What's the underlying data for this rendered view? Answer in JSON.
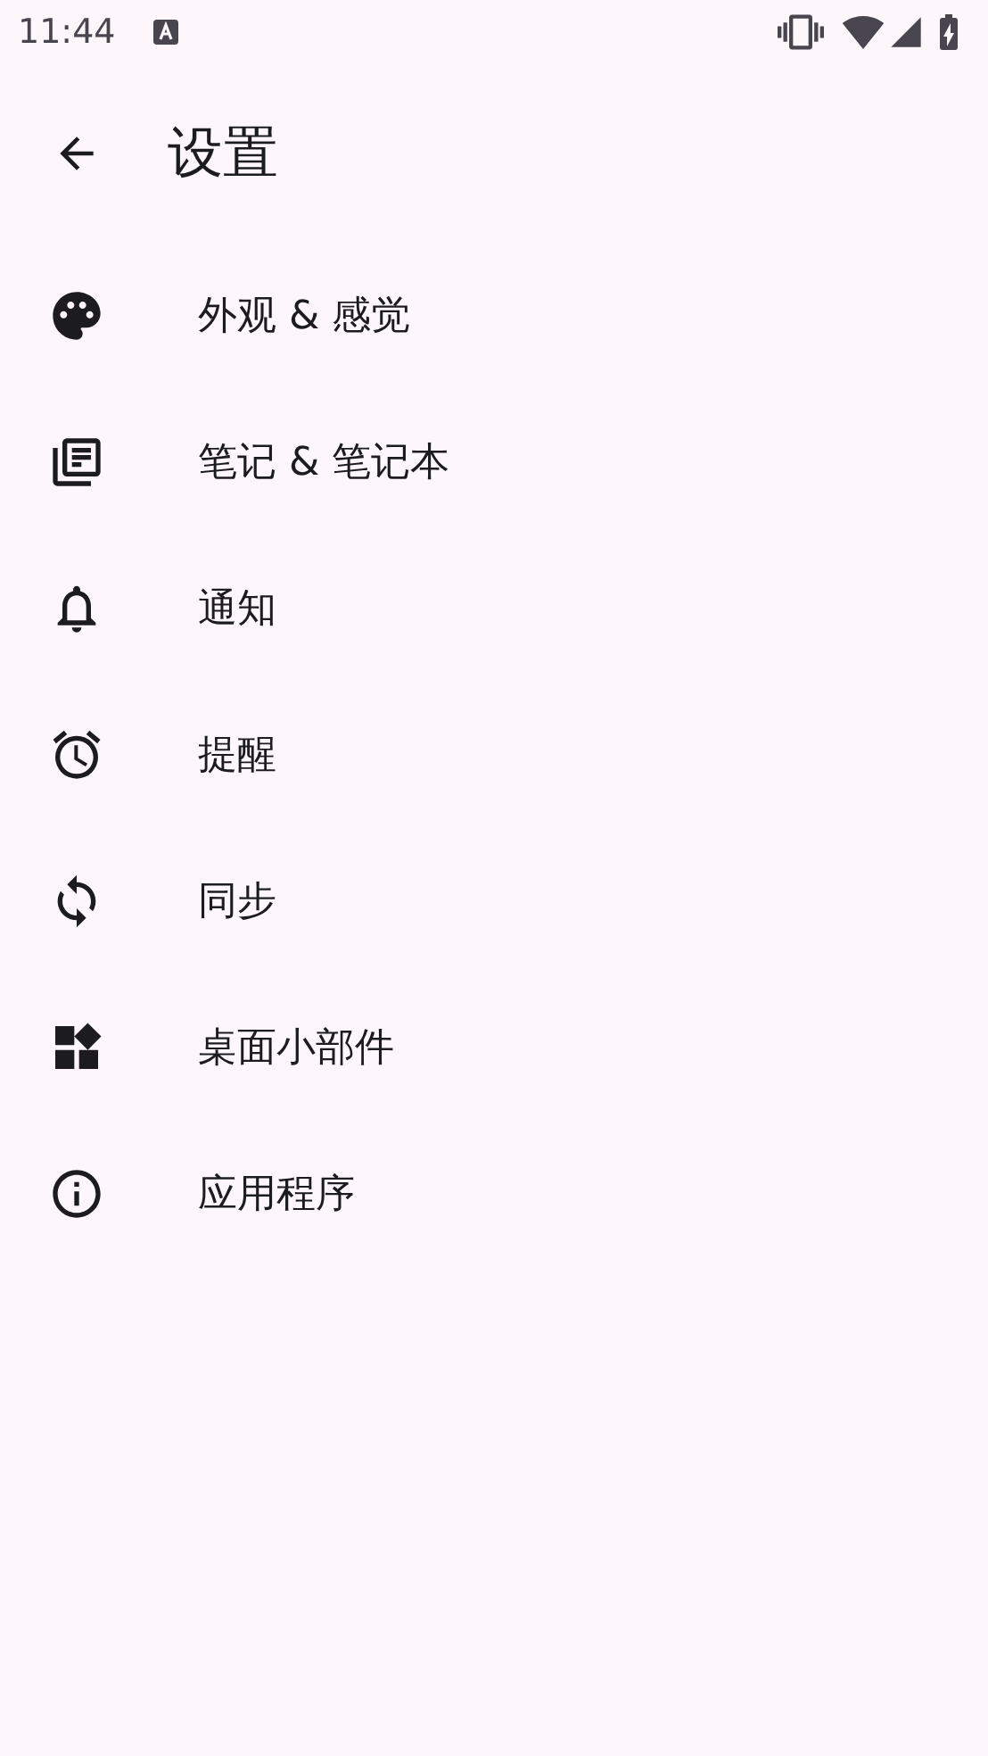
{
  "status_bar": {
    "time": "11:44"
  },
  "app_bar": {
    "title": "设置"
  },
  "items": [
    {
      "kind": "palette",
      "label": "外观 & 感觉"
    },
    {
      "kind": "notes",
      "label": "笔记 & 笔记本"
    },
    {
      "kind": "bell",
      "label": "通知"
    },
    {
      "kind": "alarm",
      "label": "提醒"
    },
    {
      "kind": "sync",
      "label": "同步"
    },
    {
      "kind": "widgets",
      "label": "桌面小部件"
    },
    {
      "kind": "info",
      "label": "应用程序"
    }
  ]
}
